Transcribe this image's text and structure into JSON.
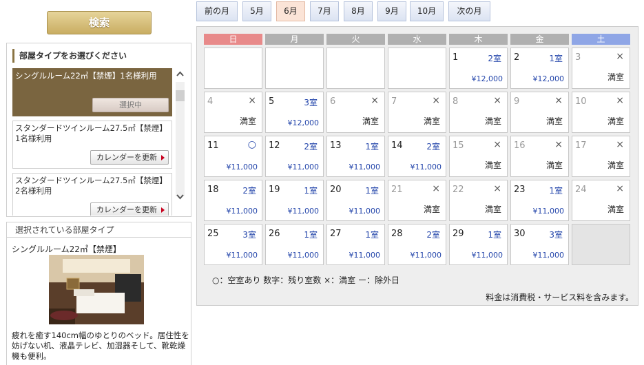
{
  "search_button": "検索",
  "room_panel": {
    "title": "部屋タイプをお選びください",
    "rooms": [
      {
        "name": "シングルルーム22㎡【禁煙】1名様利用",
        "button": "選択中"
      },
      {
        "name": "スタンダードツインルーム27.5㎡【禁煙】1名様利用",
        "button": "カレンダーを更新"
      },
      {
        "name": "スタンダードツインルーム27.5㎡【禁煙】2名様利用",
        "button": "カレンダーを更新"
      }
    ]
  },
  "selected_panel": {
    "title": "選択されている部屋タイプ",
    "room_name": "シングルルーム22㎡【禁煙】",
    "description": "疲れを癒す140cm幅のゆとりのベッド。居住性を妨げない机、液晶テレビ、加湿器そして、靴乾燥機も便利。"
  },
  "month_nav": [
    "前の月",
    "5月",
    "6月",
    "7月",
    "8月",
    "9月",
    "10月",
    "次の月"
  ],
  "current_month_index": 2,
  "weekdays": [
    "日",
    "月",
    "火",
    "水",
    "木",
    "金",
    "土"
  ],
  "calendar_days": [
    {
      "day": "1",
      "status": "2室",
      "price": "¥12,000"
    },
    {
      "day": "2",
      "status": "1室",
      "price": "¥12,000"
    },
    {
      "day": "3",
      "status": "×",
      "price": "満室",
      "past": true
    },
    {
      "day": "4",
      "status": "×",
      "price": "満室",
      "past": true
    },
    {
      "day": "5",
      "status": "3室",
      "price": "¥12,000"
    },
    {
      "day": "6",
      "status": "×",
      "price": "満室",
      "past": true
    },
    {
      "day": "7",
      "status": "×",
      "price": "満室",
      "past": true
    },
    {
      "day": "8",
      "status": "×",
      "price": "満室",
      "past": true
    },
    {
      "day": "9",
      "status": "×",
      "price": "満室",
      "past": true
    },
    {
      "day": "10",
      "status": "×",
      "price": "満室",
      "past": true
    },
    {
      "day": "11",
      "status": "○",
      "price": "¥11,000"
    },
    {
      "day": "12",
      "status": "2室",
      "price": "¥11,000"
    },
    {
      "day": "13",
      "status": "1室",
      "price": "¥11,000"
    },
    {
      "day": "14",
      "status": "2室",
      "price": "¥11,000"
    },
    {
      "day": "15",
      "status": "×",
      "price": "満室",
      "past": true
    },
    {
      "day": "16",
      "status": "×",
      "price": "満室",
      "past": true
    },
    {
      "day": "17",
      "status": "×",
      "price": "満室",
      "past": true
    },
    {
      "day": "18",
      "status": "2室",
      "price": "¥11,000"
    },
    {
      "day": "19",
      "status": "1室",
      "price": "¥11,000"
    },
    {
      "day": "20",
      "status": "1室",
      "price": "¥11,000"
    },
    {
      "day": "21",
      "status": "×",
      "price": "満室",
      "past": true
    },
    {
      "day": "22",
      "status": "×",
      "price": "満室",
      "past": true
    },
    {
      "day": "23",
      "status": "1室",
      "price": "¥11,000"
    },
    {
      "day": "24",
      "status": "×",
      "price": "満室",
      "past": true
    },
    {
      "day": "25",
      "status": "3室",
      "price": "¥11,000"
    },
    {
      "day": "26",
      "status": "1室",
      "price": "¥11,000"
    },
    {
      "day": "27",
      "status": "1室",
      "price": "¥11,000"
    },
    {
      "day": "28",
      "status": "2室",
      "price": "¥11,000"
    },
    {
      "day": "29",
      "status": "1室",
      "price": "¥11,000"
    },
    {
      "day": "30",
      "status": "3室",
      "price": "¥11,000"
    }
  ],
  "legend": "○：空室あり 数字：残り室数 ×：満室 ー：除外日",
  "tax_note": "料金は消費税・サービス料を含みます。",
  "colors": {
    "sunday_header": "#e88a8a",
    "saturday_header": "#8fa6e6",
    "weekday_header": "#b0b0b0",
    "stock_text": "#2244aa",
    "selected_room_bg": "#7a6540"
  }
}
